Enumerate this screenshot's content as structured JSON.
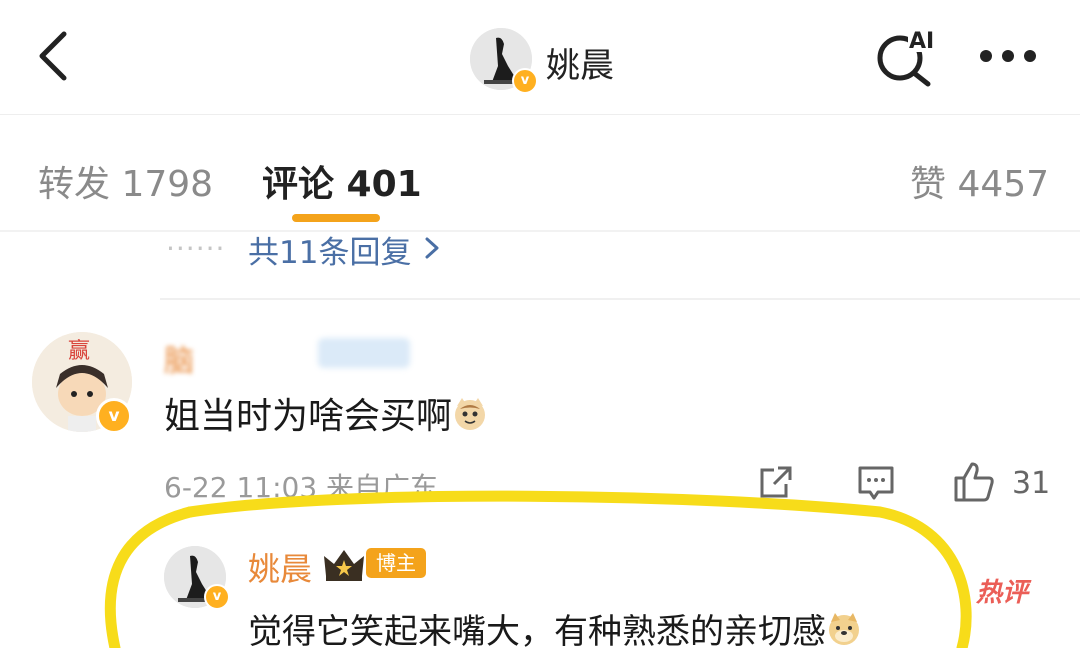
{
  "header": {
    "name": "姚晨",
    "badge": "v",
    "icons": [
      "back-icon",
      "ai-search-icon",
      "more-icon"
    ],
    "ai_label": "AI"
  },
  "tabs": [
    {
      "label": "转发 1798"
    },
    {
      "label": "评论 401"
    },
    {
      "label": "赞 4457"
    }
  ],
  "accent_color": "#f4a31b",
  "reply_summary": {
    "dots": "······",
    "count_text": "共11条回复"
  },
  "comment": {
    "username": "脑",
    "avatar_text": "赢",
    "badge": "v",
    "text": "姐当时为啥会买啊",
    "emoji": "cat-emoji",
    "meta": "6-22 11:03  来自广东",
    "likes": "31"
  },
  "author_reply": {
    "name": "姚晨",
    "badge": "v",
    "tag": "博主",
    "text": "觉得它笑起来嘴大，有种熟悉的亲切感",
    "emoji": "doge-emoji",
    "hot_tag": "热评"
  },
  "highlight_color": "#f7dc1a"
}
